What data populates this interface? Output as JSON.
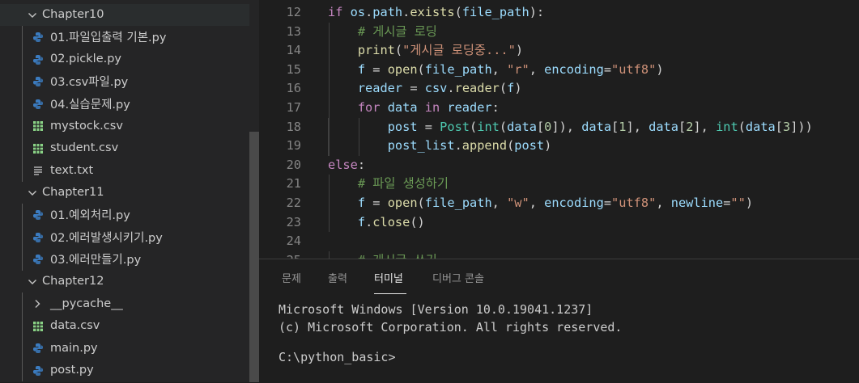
{
  "explorer": {
    "rows": [
      {
        "label": "Chapter10",
        "kind": "folder-open"
      },
      {
        "label": "01.파일입출력 기본.py",
        "kind": "py"
      },
      {
        "label": "02.pickle.py",
        "kind": "py"
      },
      {
        "label": "03.csv파일.py",
        "kind": "py"
      },
      {
        "label": "04.실습문제.py",
        "kind": "py"
      },
      {
        "label": "mystock.csv",
        "kind": "csv"
      },
      {
        "label": "student.csv",
        "kind": "csv"
      },
      {
        "label": "text.txt",
        "kind": "txt"
      },
      {
        "label": "Chapter11",
        "kind": "folder-open"
      },
      {
        "label": "01.예외처리.py",
        "kind": "py"
      },
      {
        "label": "02.에러발생시키기.py",
        "kind": "py"
      },
      {
        "label": "03.에러만들기.py",
        "kind": "py"
      },
      {
        "label": "Chapter12",
        "kind": "folder-open"
      },
      {
        "label": "__pycache__",
        "kind": "folder-closed"
      },
      {
        "label": "data.csv",
        "kind": "csv"
      },
      {
        "label": "main.py",
        "kind": "py"
      },
      {
        "label": "post.py",
        "kind": "py"
      }
    ]
  },
  "editor": {
    "lines": [
      {
        "n": "12",
        "t": [
          [
            "kw",
            "if "
          ],
          [
            "var",
            "os"
          ],
          [
            "pl",
            "."
          ],
          [
            "var",
            "path"
          ],
          [
            "pl",
            "."
          ],
          [
            "fn",
            "exists"
          ],
          [
            "pl",
            "("
          ],
          [
            "var",
            "file_path"
          ],
          [
            "pl",
            "):"
          ]
        ]
      },
      {
        "n": "13",
        "t": [
          [
            "pl",
            "    "
          ],
          [
            "cm",
            "# 게시글 로딩"
          ]
        ]
      },
      {
        "n": "14",
        "t": [
          [
            "pl",
            "    "
          ],
          [
            "fn",
            "print"
          ],
          [
            "pl",
            "("
          ],
          [
            "str",
            "\"게시글 로딩중...\""
          ],
          [
            "pl",
            ")"
          ]
        ]
      },
      {
        "n": "15",
        "t": [
          [
            "pl",
            "    "
          ],
          [
            "var",
            "f"
          ],
          [
            "pl",
            " = "
          ],
          [
            "fn",
            "open"
          ],
          [
            "pl",
            "("
          ],
          [
            "var",
            "file_path"
          ],
          [
            "pl",
            ", "
          ],
          [
            "str",
            "\"r\""
          ],
          [
            "pl",
            ", "
          ],
          [
            "var",
            "encoding"
          ],
          [
            "pl",
            "="
          ],
          [
            "str",
            "\"utf8\""
          ],
          [
            "pl",
            ")"
          ]
        ]
      },
      {
        "n": "16",
        "t": [
          [
            "pl",
            "    "
          ],
          [
            "var",
            "reader"
          ],
          [
            "pl",
            " = "
          ],
          [
            "var",
            "csv"
          ],
          [
            "pl",
            "."
          ],
          [
            "fn",
            "reader"
          ],
          [
            "pl",
            "("
          ],
          [
            "var",
            "f"
          ],
          [
            "pl",
            ")"
          ]
        ]
      },
      {
        "n": "17",
        "t": [
          [
            "pl",
            "    "
          ],
          [
            "kw",
            "for "
          ],
          [
            "var",
            "data"
          ],
          [
            "kw",
            " in "
          ],
          [
            "var",
            "reader"
          ],
          [
            "pl",
            ":"
          ]
        ]
      },
      {
        "n": "18",
        "t": [
          [
            "pl",
            "        "
          ],
          [
            "var",
            "post"
          ],
          [
            "pl",
            " = "
          ],
          [
            "cls",
            "Post"
          ],
          [
            "pl",
            "("
          ],
          [
            "bi",
            "int"
          ],
          [
            "pl",
            "("
          ],
          [
            "var",
            "data"
          ],
          [
            "pl",
            "["
          ],
          [
            "num",
            "0"
          ],
          [
            "pl",
            "]), "
          ],
          [
            "var",
            "data"
          ],
          [
            "pl",
            "["
          ],
          [
            "num",
            "1"
          ],
          [
            "pl",
            "], "
          ],
          [
            "var",
            "data"
          ],
          [
            "pl",
            "["
          ],
          [
            "num",
            "2"
          ],
          [
            "pl",
            "], "
          ],
          [
            "bi",
            "int"
          ],
          [
            "pl",
            "("
          ],
          [
            "var",
            "data"
          ],
          [
            "pl",
            "["
          ],
          [
            "num",
            "3"
          ],
          [
            "pl",
            "]))"
          ]
        ]
      },
      {
        "n": "19",
        "t": [
          [
            "pl",
            "        "
          ],
          [
            "var",
            "post_list"
          ],
          [
            "pl",
            "."
          ],
          [
            "fn",
            "append"
          ],
          [
            "pl",
            "("
          ],
          [
            "var",
            "post"
          ],
          [
            "pl",
            ")"
          ]
        ]
      },
      {
        "n": "20",
        "t": [
          [
            "kw",
            "else"
          ],
          [
            "pl",
            ":"
          ]
        ]
      },
      {
        "n": "21",
        "t": [
          [
            "pl",
            "    "
          ],
          [
            "cm",
            "# 파일 생성하기"
          ]
        ]
      },
      {
        "n": "22",
        "t": [
          [
            "pl",
            "    "
          ],
          [
            "var",
            "f"
          ],
          [
            "pl",
            " = "
          ],
          [
            "fn",
            "open"
          ],
          [
            "pl",
            "("
          ],
          [
            "var",
            "file_path"
          ],
          [
            "pl",
            ", "
          ],
          [
            "str",
            "\"w\""
          ],
          [
            "pl",
            ", "
          ],
          [
            "var",
            "encoding"
          ],
          [
            "pl",
            "="
          ],
          [
            "str",
            "\"utf8\""
          ],
          [
            "pl",
            ", "
          ],
          [
            "var",
            "newline"
          ],
          [
            "pl",
            "="
          ],
          [
            "str",
            "\"\""
          ],
          [
            "pl",
            ")"
          ]
        ]
      },
      {
        "n": "23",
        "t": [
          [
            "pl",
            "    "
          ],
          [
            "var",
            "f"
          ],
          [
            "pl",
            "."
          ],
          [
            "fn",
            "close"
          ],
          [
            "pl",
            "()"
          ]
        ]
      },
      {
        "n": "24",
        "t": []
      },
      {
        "n": "25",
        "t": [
          [
            "pl",
            "    "
          ],
          [
            "cm",
            "# 게시글 쓰기"
          ]
        ]
      }
    ]
  },
  "panel": {
    "tabs": [
      "문제",
      "출력",
      "터미널",
      "디버그 콘솔"
    ],
    "active_tab": "터미널",
    "terminal_lines": [
      "Microsoft Windows [Version 10.0.19041.1237]",
      "(c) Microsoft Corporation. All rights reserved.",
      "",
      "C:\\python_basic>"
    ]
  },
  "colors": {
    "py_icon": "#3b7bbf",
    "py_icon_alt": "#f2c94c",
    "csv_icon": "#89d185",
    "txt_icon": "#cccccc"
  }
}
